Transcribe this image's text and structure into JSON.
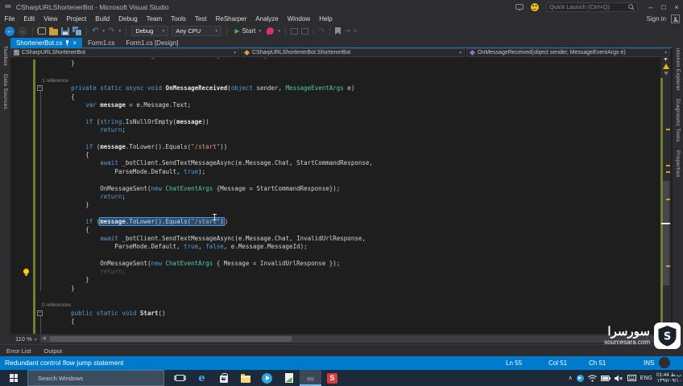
{
  "window": {
    "title": "CSharpURLShortenerBot - Microsoft Visual Studio",
    "quick_launch_placeholder": "Quick Launch (Ctrl+Q)",
    "sign_in": "Sign in"
  },
  "menus": [
    "File",
    "Edit",
    "View",
    "Project",
    "Build",
    "Debug",
    "Team",
    "Tools",
    "Test",
    "ReSharper",
    "Analyze",
    "Window",
    "Help"
  ],
  "toolbar": {
    "configuration": "Debug",
    "platform": "Any CPU",
    "start_label": "Start"
  },
  "document_tabs": [
    {
      "label": "ShortenerBot.cs",
      "active": true
    },
    {
      "label": "Form1.cs",
      "active": false
    },
    {
      "label": "Form1.cs [Design]",
      "active": false
    }
  ],
  "breadcrumb": {
    "project": "CSharpURLShortenerBot",
    "type": "CSharpURLShortenerBot.ShortenerBot",
    "member": "OnMessageReceived(object sender, MessageEventArgs e)"
  },
  "left_tool_tabs": [
    "Toolbox",
    "Data Sources"
  ],
  "right_tool_tabs": [
    "Solution Explorer",
    "Diagnostic Tools",
    "Properties"
  ],
  "editor": {
    "zoom_level": "110 %",
    "lines": [
      {
        "t": [
          [
            "p",
            "                              _botClient.OnMessage += OnMessageReceived;"
          ]
        ]
      },
      {
        "t": [
          [
            "p",
            "        }"
          ]
        ]
      },
      {
        "t": []
      },
      {
        "cl": "1 reference"
      },
      {
        "t": [
          [
            "p",
            "        "
          ],
          [
            "k",
            "private static async void "
          ],
          [
            "m",
            "OnMessageReceived"
          ],
          [
            "p",
            "("
          ],
          [
            "k",
            "object"
          ],
          [
            "p",
            " sender, "
          ],
          [
            "ty",
            "MessageEventArgs"
          ],
          [
            "p",
            " e)"
          ]
        ]
      },
      {
        "t": [
          [
            "p",
            "        {"
          ]
        ]
      },
      {
        "t": [
          [
            "p",
            "            "
          ],
          [
            "k",
            "var "
          ],
          [
            "m",
            "message"
          ],
          [
            "p",
            " = e.Message.Text;"
          ]
        ]
      },
      {
        "t": []
      },
      {
        "t": [
          [
            "p",
            "            "
          ],
          [
            "k",
            "if"
          ],
          [
            "p",
            " ("
          ],
          [
            "k",
            "string"
          ],
          [
            "p",
            ".IsNullOrEmpty("
          ],
          [
            "m",
            "message"
          ],
          [
            "p",
            "))"
          ]
        ]
      },
      {
        "t": [
          [
            "p",
            "                "
          ],
          [
            "k",
            "return"
          ],
          [
            "p",
            ";"
          ]
        ]
      },
      {
        "t": []
      },
      {
        "t": [
          [
            "p",
            "            "
          ],
          [
            "k",
            "if"
          ],
          [
            "p",
            " ("
          ],
          [
            "m",
            "message"
          ],
          [
            "p",
            ".ToLower().Equals("
          ],
          [
            "s",
            "\"/start\""
          ],
          [
            "p",
            "))"
          ]
        ]
      },
      {
        "t": [
          [
            "p",
            "            {"
          ]
        ]
      },
      {
        "t": [
          [
            "p",
            "                "
          ],
          [
            "k",
            "await"
          ],
          [
            "p",
            " _botClient.SendTextMessageAsync(e.Message.Chat, StartCommandResponse,"
          ]
        ]
      },
      {
        "t": [
          [
            "p",
            "                    ParseMode.Default, "
          ],
          [
            "k",
            "true"
          ],
          [
            "p",
            ");"
          ]
        ]
      },
      {
        "t": []
      },
      {
        "t": [
          [
            "p",
            "                OnMessageSent("
          ],
          [
            "k",
            "new"
          ],
          [
            "ty",
            " ChatEventArgs"
          ],
          [
            "p",
            " {Message = StartCommandResponse});"
          ]
        ]
      },
      {
        "t": [
          [
            "p",
            "                "
          ],
          [
            "k",
            "return"
          ],
          [
            "p",
            ";"
          ]
        ]
      },
      {
        "t": [
          [
            "p",
            "            }"
          ]
        ]
      },
      {
        "t": []
      },
      {
        "t": [
          [
            "p",
            "            "
          ],
          [
            "k",
            "if"
          ],
          [
            "p",
            " ("
          ],
          [
            "SEL",
            [
              [
                "m",
                "message"
              ],
              [
                "p",
                ".ToLower().Equals("
              ],
              [
                "s",
                "\"/start\""
              ],
              [
                "p",
                ")"
              ]
            ]
          ],
          [
            "CARET",
            ""
          ],
          [
            "p",
            ")"
          ]
        ]
      },
      {
        "t": [
          [
            "p",
            "            {"
          ]
        ]
      },
      {
        "t": [
          [
            "p",
            "                "
          ],
          [
            "k",
            "await"
          ],
          [
            "p",
            " _botClient.SendTextMessageAsync(e.Message.Chat, InvalidUrlResponse,"
          ]
        ]
      },
      {
        "t": [
          [
            "p",
            "                    ParseMode.Default, "
          ],
          [
            "k",
            "true"
          ],
          [
            "p",
            ", "
          ],
          [
            "k",
            "false"
          ],
          [
            "p",
            ", e.Message.MessageId);"
          ]
        ]
      },
      {
        "t": []
      },
      {
        "t": [
          [
            "p",
            "                OnMessageSent("
          ],
          [
            "k",
            "new"
          ],
          [
            "ty",
            " ChatEventArgs"
          ],
          [
            "p",
            " { Message = InvalidUrlResponse });"
          ]
        ]
      },
      {
        "t": [
          [
            "p",
            "                "
          ],
          [
            "d",
            "return;"
          ]
        ]
      },
      {
        "t": [
          [
            "p",
            "            }"
          ]
        ]
      },
      {
        "t": [
          [
            "p",
            "        }"
          ]
        ]
      },
      {
        "t": []
      },
      {
        "cl": "0 references"
      },
      {
        "t": [
          [
            "p",
            "        "
          ],
          [
            "k",
            "public static void "
          ],
          [
            "m",
            "Start"
          ],
          [
            "p",
            "()"
          ]
        ]
      },
      {
        "t": [
          [
            "p",
            "        {"
          ]
        ]
      }
    ]
  },
  "panel_tabs": [
    "Error List",
    "Output"
  ],
  "status_bar": {
    "message": "Redundant control flow jump statement",
    "line": "Ln 55",
    "column": "Col 51",
    "character": "Ch 51",
    "mode": "INS"
  },
  "watermark": {
    "title_fa": "سورسرا",
    "site": "sourcesara.com",
    "logo_letter": "S"
  },
  "taskbar": {
    "search_placeholder": "Search Windows",
    "language": "ENG",
    "time": "01:44 ب.ظ",
    "date": "۱۳۹۷/۰۹/۱۰"
  },
  "icons": {
    "vs_logo": "∞",
    "back": "←",
    "forward": "→",
    "undo": "↶",
    "redo": "↷",
    "dropdown": "▾",
    "minimize": "–",
    "restore": "□",
    "close": "×",
    "play": "▶",
    "scroll_up": "▲",
    "scroll_down": "▼",
    "scroll_left": "◀",
    "scroll_right": "▶",
    "tray_chevron": "∧",
    "edge": "e",
    "vs_taskbar": "∞"
  },
  "colors": {
    "status_bar": "#007acc",
    "active_tab": "#007acc",
    "selection": "#264f78",
    "keyword": "#569cd6",
    "type": "#4ec9b0",
    "string": "#d69d85",
    "change_bar_green": "#6e8033",
    "warning": "#e8b71a",
    "taskbar": "#1d2a39"
  }
}
